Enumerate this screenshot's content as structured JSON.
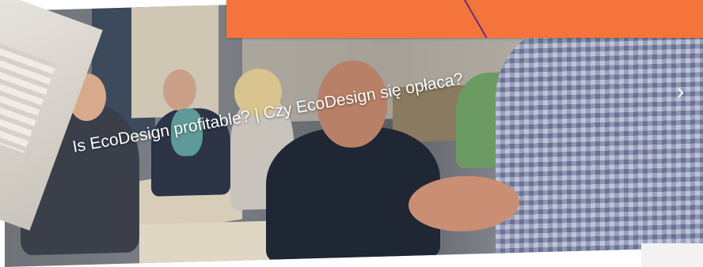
{
  "video": {
    "caption": "Is EcoDesign profitable? | Czy EcoDesign się opłaca?",
    "next_arrow": "›"
  },
  "colors": {
    "banner": "#f4743c",
    "accent_line": "#4a2a8a"
  }
}
